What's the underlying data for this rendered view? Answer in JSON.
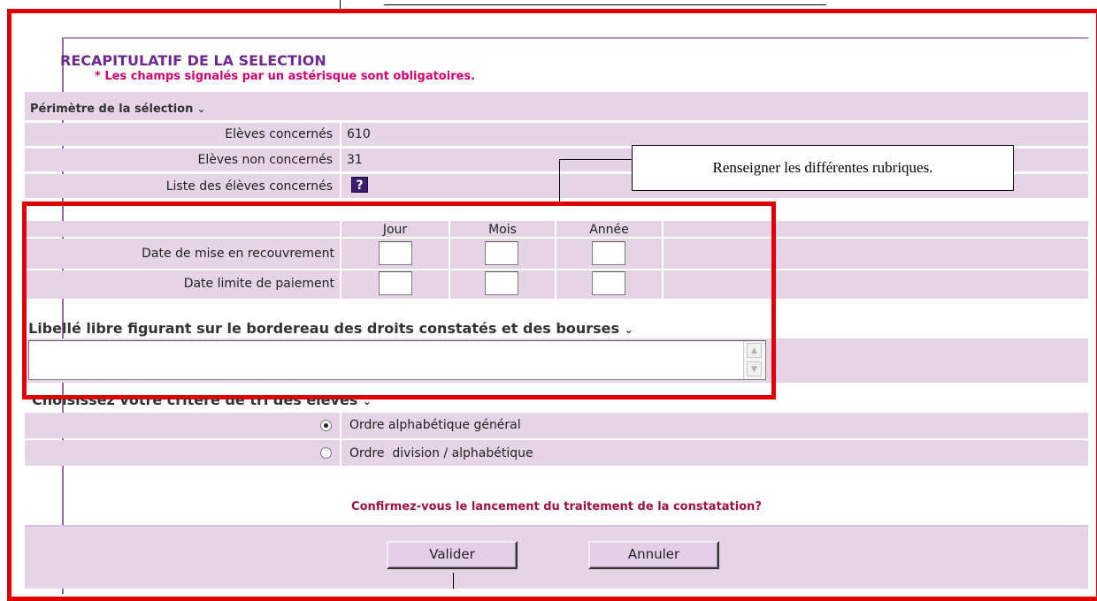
{
  "header": {
    "title": "RECAPITULATIF DE LA SELECTION",
    "required_note": "* Les champs signalés par un astérisque sont obligatoires."
  },
  "perimetre": {
    "section_label": "Périmètre de la sélection",
    "rows": [
      {
        "label": "Elèves concernés",
        "value": "610"
      },
      {
        "label": "Elèves non concernés",
        "value": "31"
      },
      {
        "label": "Liste des élèves concernés",
        "icon": "help-icon"
      }
    ]
  },
  "callout": {
    "text": "Renseigner les différentes rubriques."
  },
  "dates": {
    "col_jour": "Jour",
    "col_mois": "Mois",
    "col_annee": "Année",
    "row1_label": "Date de mise en recouvrement",
    "row2_label": "Date limite de paiement",
    "row1_values": {
      "jour": "",
      "mois": "",
      "annee": ""
    },
    "row2_values": {
      "jour": "",
      "mois": "",
      "annee": ""
    }
  },
  "libelle": {
    "heading": "Libellé libre figurant sur le bordereau des droits constatés et des bourses",
    "value": ""
  },
  "tri": {
    "heading": "Choisissez votre critère de tri des élèves",
    "options": [
      {
        "label": "Ordre alphabétique général",
        "selected": true
      },
      {
        "label": "Ordre  division / alphabétique",
        "selected": false
      }
    ]
  },
  "confirm": {
    "question": "Confirmez-vous le lancement du traitement de la constatation?"
  },
  "buttons": {
    "valider": "Valider",
    "annuler": "Annuler"
  },
  "colors": {
    "band": "#e4d4e6",
    "title": "#6b2a8c",
    "required": "#d0006f",
    "confirm": "#a01040",
    "annotation_frame": "#e00000"
  }
}
